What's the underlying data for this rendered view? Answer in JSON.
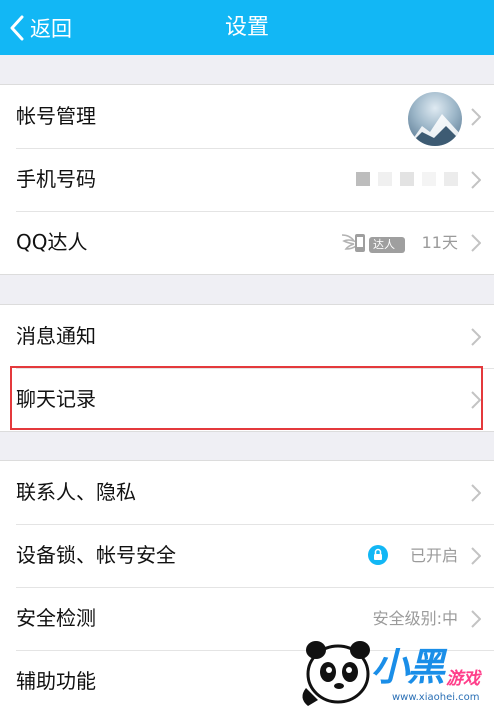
{
  "header": {
    "back_label": "返回",
    "title": "设置",
    "background": "#12b7f5"
  },
  "groups": [
    {
      "items": [
        {
          "label": "帐号管理",
          "trailing": "avatar"
        },
        {
          "label": "手机号码",
          "trailing": "masked"
        },
        {
          "label": "QQ达人",
          "badge_text": "达人",
          "value": "11天"
        }
      ]
    },
    {
      "items": [
        {
          "label": "消息通知"
        },
        {
          "label": "聊天记录",
          "highlighted": true
        }
      ]
    },
    {
      "items": [
        {
          "label": "联系人、隐私"
        },
        {
          "label": "设备锁、帐号安全",
          "value": "已开启",
          "icon": "lock-icon"
        },
        {
          "label": "安全检测",
          "value": "安全级别:中"
        },
        {
          "label": "辅助功能"
        }
      ]
    }
  ],
  "watermark": {
    "text_main": "小黑",
    "text_sub": "游戏",
    "url": "www.xiaohei.com"
  },
  "colors": {
    "accent": "#12b7f5",
    "highlight": "#e4393c",
    "secondary_text": "#9b9b9b"
  }
}
